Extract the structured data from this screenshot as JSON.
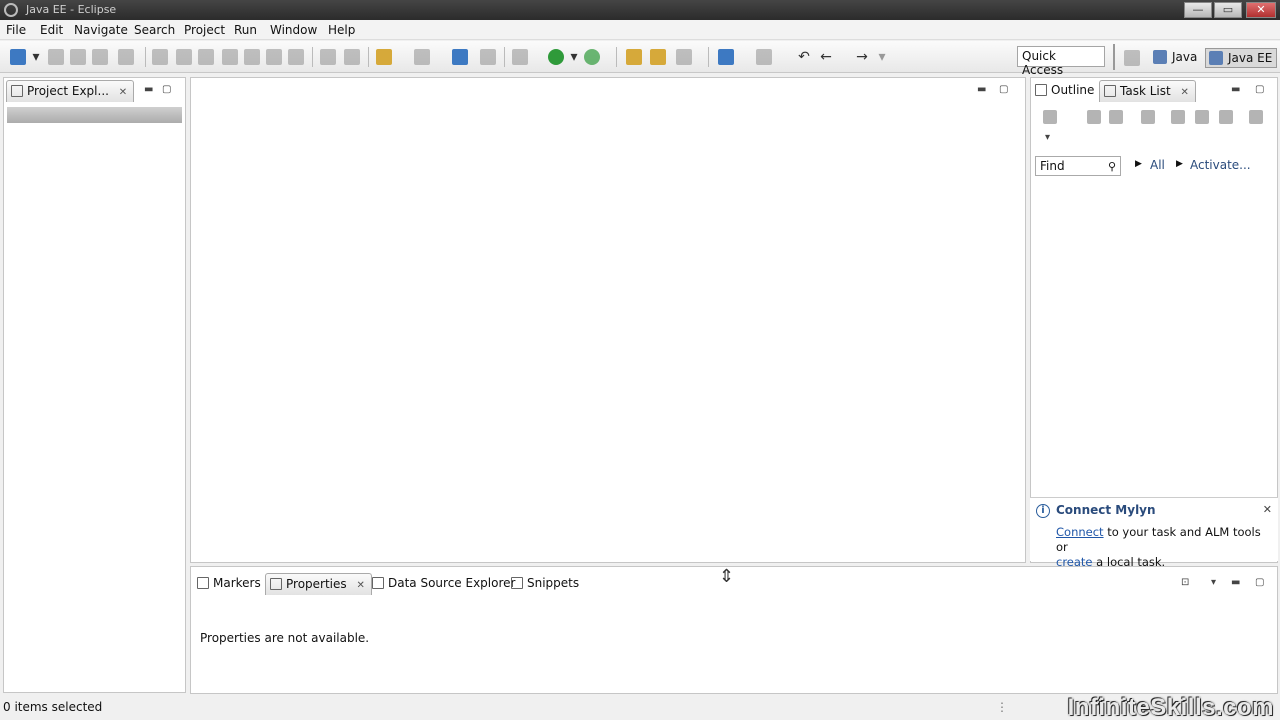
{
  "window": {
    "title": "Java EE - Eclipse",
    "minimize_label": "—",
    "maximize_label": "▭",
    "close_label": "✕"
  },
  "menu": [
    "File",
    "Edit",
    "Navigate",
    "Search",
    "Project",
    "Run",
    "Window",
    "Help"
  ],
  "toolbar": {
    "quick_access": "Quick Access",
    "perspectives": [
      {
        "label": "Java",
        "active": false
      },
      {
        "label": "Java EE",
        "active": true
      }
    ]
  },
  "project_explorer": {
    "tab_label": "Project Expl...",
    "close_label": "✕"
  },
  "task_panel": {
    "tabs": [
      {
        "label": "Outline",
        "icon": "outline-icon"
      },
      {
        "label": "Task List",
        "icon": "task-list-icon"
      }
    ],
    "find_placeholder": "Find",
    "filter_all": "All",
    "filter_activate": "Activate...",
    "close_label": "✕"
  },
  "mylyn": {
    "title": "Connect Mylyn",
    "connect_link": "Connect",
    "text1": " to your task and ALM tools or",
    "create_link": "create",
    "text2": " a local task.",
    "close_label": "✕"
  },
  "bottom_panel": {
    "tabs": [
      {
        "label": "Markers"
      },
      {
        "label": "Properties"
      },
      {
        "label": "Data Source Explorer"
      },
      {
        "label": "Snippets"
      }
    ],
    "message": "Properties are not available.",
    "close_label": "✕"
  },
  "status": {
    "selection": "0 items selected"
  },
  "watermark": "InfiniteSkills.com",
  "colors": {
    "link": "#1f56a8",
    "title_bar": "#3a3a3a",
    "mylyn_title": "#2a4b7c"
  }
}
